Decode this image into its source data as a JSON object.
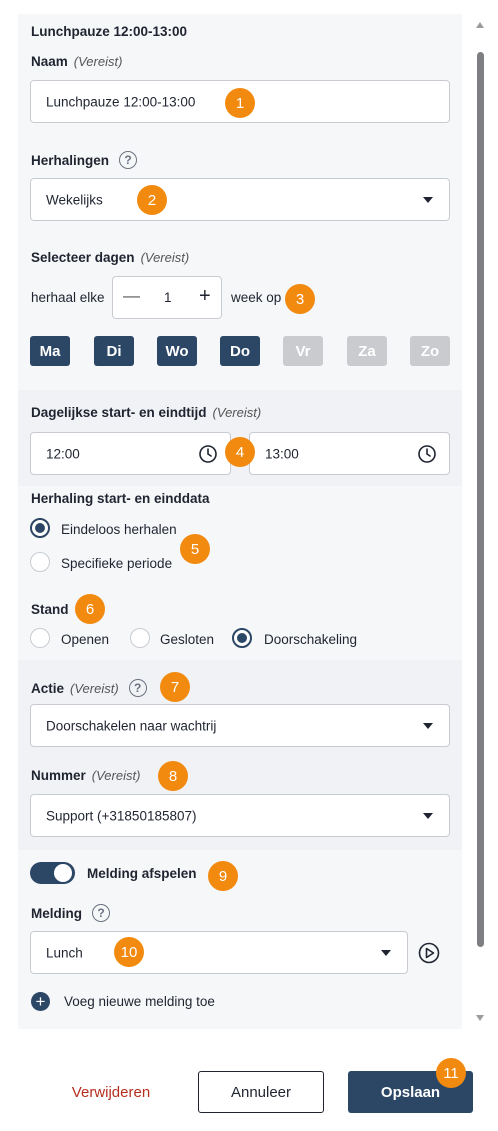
{
  "header": {
    "title": "Lunchpauze 12:00-13:00"
  },
  "name_field": {
    "label": "Naam",
    "required": "(Vereist)",
    "value": "Lunchpauze 12:00-13:00"
  },
  "repeat": {
    "label": "Herhalingen",
    "value": "Wekelijks"
  },
  "days": {
    "label": "Selecteer dagen",
    "required": "(Vereist)",
    "repeat_every": "herhaal elke",
    "interval": "1",
    "week_on": "week op",
    "minus": "—",
    "plus": "+",
    "items": [
      {
        "label": "Ma",
        "active": true
      },
      {
        "label": "Di",
        "active": true
      },
      {
        "label": "Wo",
        "active": true
      },
      {
        "label": "Do",
        "active": true
      },
      {
        "label": "Vr",
        "active": false
      },
      {
        "label": "Za",
        "active": false
      },
      {
        "label": "Zo",
        "active": false
      }
    ]
  },
  "times": {
    "label": "Dagelijkse start- en eindtijd",
    "required": "(Vereist)",
    "start": "12:00",
    "end": "13:00"
  },
  "dates": {
    "label": "Herhaling start- en einddata",
    "option_endless": "Eindeloos herhalen",
    "option_specific": "Specifieke periode"
  },
  "stand": {
    "label": "Stand",
    "open": "Openen",
    "closed": "Gesloten",
    "forward": "Doorschakeling"
  },
  "action": {
    "label": "Actie",
    "required": "(Vereist)",
    "value": "Doorschakelen naar wachtrij"
  },
  "number": {
    "label": "Nummer",
    "required": "(Vereist)",
    "value": "Support (+31850185807)"
  },
  "play_toggle": {
    "label": "Melding afspelen",
    "on": true
  },
  "message": {
    "label": "Melding",
    "value": "Lunch",
    "add_label": "Voeg nieuwe melding toe"
  },
  "footer": {
    "delete": "Verwijderen",
    "cancel": "Annuleer",
    "save": "Opslaan"
  },
  "badges": [
    "1",
    "2",
    "3",
    "4",
    "5",
    "6",
    "7",
    "8",
    "9",
    "10",
    "11"
  ],
  "colors": {
    "primary": "#2c4766",
    "badge": "#f28a10",
    "delete": "#b5301f",
    "day_off": "#c9cbcf"
  }
}
